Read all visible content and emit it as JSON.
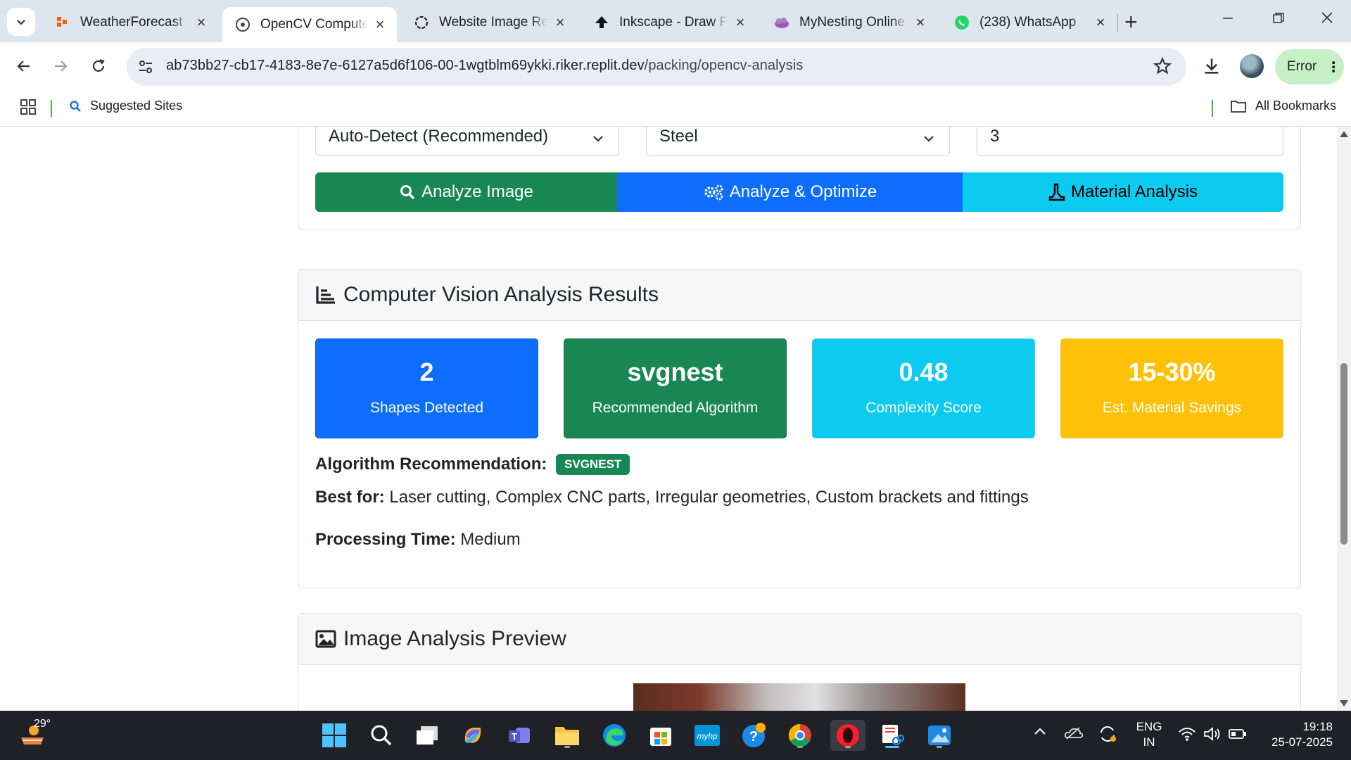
{
  "browser": {
    "tabs": [
      {
        "title": "WeatherForecast -",
        "icon": "weatherforecast-icon",
        "active": false
      },
      {
        "title": "OpenCV Computer",
        "icon": "replit-icon",
        "active": true
      },
      {
        "title": "Website Image Rec",
        "icon": "chatgpt-icon",
        "active": false
      },
      {
        "title": "Inkscape - Draw Fr",
        "icon": "inkscape-icon",
        "active": false
      },
      {
        "title": "MyNesting Online",
        "icon": "mynesting-icon",
        "active": false
      },
      {
        "title": "(238) WhatsApp",
        "icon": "whatsapp-icon",
        "active": false
      }
    ],
    "url_host": "ab73bb27-cb17-4183-8e7e-6127a5d6f106-00-1wgtblm69ykki.riker.replit.dev",
    "url_path": "/packing/opencv-analysis",
    "error_label": "Error",
    "bookmarks": {
      "suggested": "Suggested Sites",
      "all": "All Bookmarks"
    }
  },
  "form": {
    "shape_select": "Auto-Detect (Recommended)",
    "material_select": "Steel",
    "quantity": "3",
    "buttons": {
      "analyze": "Analyze Image",
      "optimize": "Analyze & Optimize",
      "material": "Material Analysis"
    }
  },
  "results": {
    "header": "Computer Vision Analysis Results",
    "stats": [
      {
        "value": "2",
        "label": "Shapes Detected"
      },
      {
        "value": "svgnest",
        "label": "Recommended Algorithm"
      },
      {
        "value": "0.48",
        "label": "Complexity Score"
      },
      {
        "value": "15-30%",
        "label": "Est. Material Savings"
      }
    ],
    "algo_label": "Algorithm Recommendation:",
    "algo_badge": "SVGNEST",
    "bestfor_label": "Best for:",
    "bestfor_value": " Laser cutting, Complex CNC parts, Irregular geometries, Custom brackets and fittings",
    "time_label": "Processing Time:",
    "time_value": " Medium"
  },
  "preview": {
    "header": "Image Analysis Preview"
  },
  "taskbar": {
    "weather_temp": "29°",
    "lang_top": "ENG",
    "lang_bottom": "IN",
    "time": "19:18",
    "date": "25-07-2025"
  },
  "colors": {
    "primary": "#0d6efd",
    "success": "#198754",
    "info": "#0dcaf0",
    "warning": "#ffc107"
  }
}
